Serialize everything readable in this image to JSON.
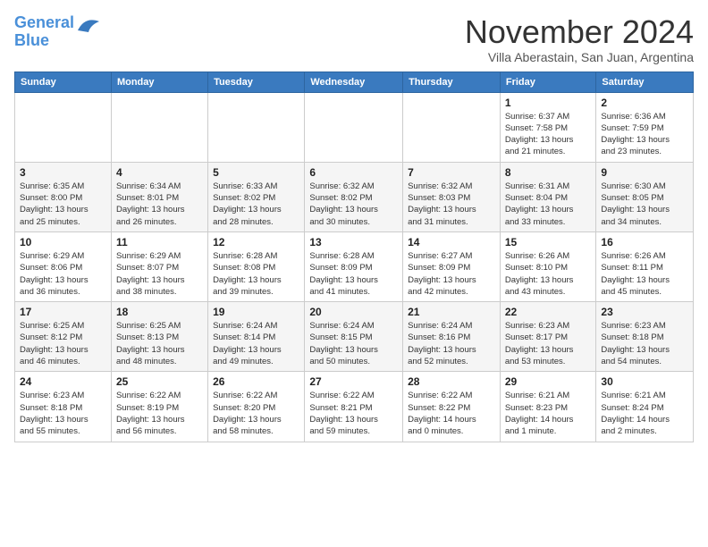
{
  "header": {
    "logo_line1": "General",
    "logo_line2": "Blue",
    "month": "November 2024",
    "location": "Villa Aberastain, San Juan, Argentina"
  },
  "weekdays": [
    "Sunday",
    "Monday",
    "Tuesday",
    "Wednesday",
    "Thursday",
    "Friday",
    "Saturday"
  ],
  "weeks": [
    [
      {
        "day": "",
        "info": ""
      },
      {
        "day": "",
        "info": ""
      },
      {
        "day": "",
        "info": ""
      },
      {
        "day": "",
        "info": ""
      },
      {
        "day": "",
        "info": ""
      },
      {
        "day": "1",
        "info": "Sunrise: 6:37 AM\nSunset: 7:58 PM\nDaylight: 13 hours\nand 21 minutes."
      },
      {
        "day": "2",
        "info": "Sunrise: 6:36 AM\nSunset: 7:59 PM\nDaylight: 13 hours\nand 23 minutes."
      }
    ],
    [
      {
        "day": "3",
        "info": "Sunrise: 6:35 AM\nSunset: 8:00 PM\nDaylight: 13 hours\nand 25 minutes."
      },
      {
        "day": "4",
        "info": "Sunrise: 6:34 AM\nSunset: 8:01 PM\nDaylight: 13 hours\nand 26 minutes."
      },
      {
        "day": "5",
        "info": "Sunrise: 6:33 AM\nSunset: 8:02 PM\nDaylight: 13 hours\nand 28 minutes."
      },
      {
        "day": "6",
        "info": "Sunrise: 6:32 AM\nSunset: 8:02 PM\nDaylight: 13 hours\nand 30 minutes."
      },
      {
        "day": "7",
        "info": "Sunrise: 6:32 AM\nSunset: 8:03 PM\nDaylight: 13 hours\nand 31 minutes."
      },
      {
        "day": "8",
        "info": "Sunrise: 6:31 AM\nSunset: 8:04 PM\nDaylight: 13 hours\nand 33 minutes."
      },
      {
        "day": "9",
        "info": "Sunrise: 6:30 AM\nSunset: 8:05 PM\nDaylight: 13 hours\nand 34 minutes."
      }
    ],
    [
      {
        "day": "10",
        "info": "Sunrise: 6:29 AM\nSunset: 8:06 PM\nDaylight: 13 hours\nand 36 minutes."
      },
      {
        "day": "11",
        "info": "Sunrise: 6:29 AM\nSunset: 8:07 PM\nDaylight: 13 hours\nand 38 minutes."
      },
      {
        "day": "12",
        "info": "Sunrise: 6:28 AM\nSunset: 8:08 PM\nDaylight: 13 hours\nand 39 minutes."
      },
      {
        "day": "13",
        "info": "Sunrise: 6:28 AM\nSunset: 8:09 PM\nDaylight: 13 hours\nand 41 minutes."
      },
      {
        "day": "14",
        "info": "Sunrise: 6:27 AM\nSunset: 8:09 PM\nDaylight: 13 hours\nand 42 minutes."
      },
      {
        "day": "15",
        "info": "Sunrise: 6:26 AM\nSunset: 8:10 PM\nDaylight: 13 hours\nand 43 minutes."
      },
      {
        "day": "16",
        "info": "Sunrise: 6:26 AM\nSunset: 8:11 PM\nDaylight: 13 hours\nand 45 minutes."
      }
    ],
    [
      {
        "day": "17",
        "info": "Sunrise: 6:25 AM\nSunset: 8:12 PM\nDaylight: 13 hours\nand 46 minutes."
      },
      {
        "day": "18",
        "info": "Sunrise: 6:25 AM\nSunset: 8:13 PM\nDaylight: 13 hours\nand 48 minutes."
      },
      {
        "day": "19",
        "info": "Sunrise: 6:24 AM\nSunset: 8:14 PM\nDaylight: 13 hours\nand 49 minutes."
      },
      {
        "day": "20",
        "info": "Sunrise: 6:24 AM\nSunset: 8:15 PM\nDaylight: 13 hours\nand 50 minutes."
      },
      {
        "day": "21",
        "info": "Sunrise: 6:24 AM\nSunset: 8:16 PM\nDaylight: 13 hours\nand 52 minutes."
      },
      {
        "day": "22",
        "info": "Sunrise: 6:23 AM\nSunset: 8:17 PM\nDaylight: 13 hours\nand 53 minutes."
      },
      {
        "day": "23",
        "info": "Sunrise: 6:23 AM\nSunset: 8:18 PM\nDaylight: 13 hours\nand 54 minutes."
      }
    ],
    [
      {
        "day": "24",
        "info": "Sunrise: 6:23 AM\nSunset: 8:18 PM\nDaylight: 13 hours\nand 55 minutes."
      },
      {
        "day": "25",
        "info": "Sunrise: 6:22 AM\nSunset: 8:19 PM\nDaylight: 13 hours\nand 56 minutes."
      },
      {
        "day": "26",
        "info": "Sunrise: 6:22 AM\nSunset: 8:20 PM\nDaylight: 13 hours\nand 58 minutes."
      },
      {
        "day": "27",
        "info": "Sunrise: 6:22 AM\nSunset: 8:21 PM\nDaylight: 13 hours\nand 59 minutes."
      },
      {
        "day": "28",
        "info": "Sunrise: 6:22 AM\nSunset: 8:22 PM\nDaylight: 14 hours\nand 0 minutes."
      },
      {
        "day": "29",
        "info": "Sunrise: 6:21 AM\nSunset: 8:23 PM\nDaylight: 14 hours\nand 1 minute."
      },
      {
        "day": "30",
        "info": "Sunrise: 6:21 AM\nSunset: 8:24 PM\nDaylight: 14 hours\nand 2 minutes."
      }
    ]
  ]
}
